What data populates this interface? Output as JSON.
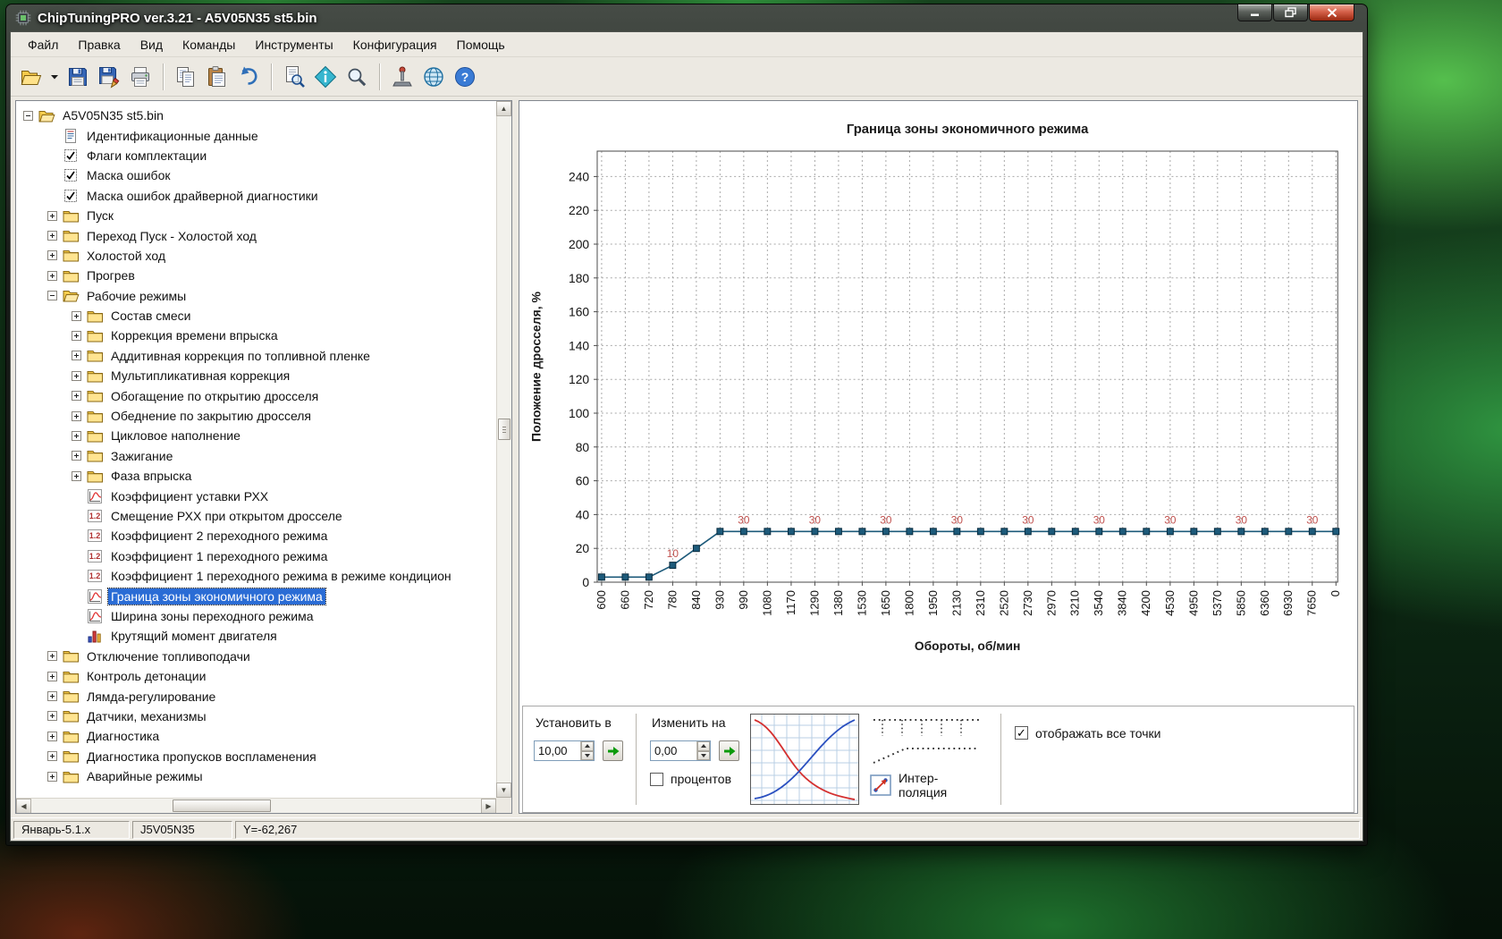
{
  "window": {
    "title": "ChipTuningPRO ver.3.21 - A5V05N35 st5.bin"
  },
  "menu": {
    "items": [
      {
        "key": "file",
        "label": "Файл"
      },
      {
        "key": "edit",
        "label": "Правка"
      },
      {
        "key": "view",
        "label": "Вид"
      },
      {
        "key": "commands",
        "label": "Команды"
      },
      {
        "key": "tools",
        "label": "Инструменты"
      },
      {
        "key": "configuration",
        "label": "Конфигурация"
      },
      {
        "key": "help",
        "label": "Помощь"
      }
    ]
  },
  "toolbar": {
    "buttons": [
      {
        "name": "open-file-button",
        "icon": "open"
      },
      {
        "name": "open-dropdown-button",
        "icon": "dropdown"
      },
      {
        "name": "save-button",
        "icon": "save"
      },
      {
        "name": "save-as-button",
        "icon": "save-as"
      },
      {
        "name": "print-button",
        "icon": "print"
      },
      {
        "name": "separator"
      },
      {
        "name": "copy-button",
        "icon": "copy"
      },
      {
        "name": "paste-button",
        "icon": "paste"
      },
      {
        "name": "undo-button",
        "icon": "undo"
      },
      {
        "name": "separator"
      },
      {
        "name": "preview-button",
        "icon": "preview"
      },
      {
        "name": "properties-button",
        "icon": "info"
      },
      {
        "name": "search-button",
        "icon": "search"
      },
      {
        "name": "separator"
      },
      {
        "name": "tools-button",
        "icon": "tools"
      },
      {
        "name": "globe-button",
        "icon": "globe"
      },
      {
        "name": "help-button",
        "icon": "help"
      }
    ]
  },
  "tree": {
    "items": [
      {
        "label": "A5V05N35 st5.bin",
        "level": 0,
        "icon": "folder-open",
        "expander": "minus"
      },
      {
        "label": "Идентификационные данные",
        "level": 1,
        "icon": "doc"
      },
      {
        "label": "Флаги комплектации",
        "level": 1,
        "icon": "check"
      },
      {
        "label": "Маска ошибок",
        "level": 1,
        "icon": "check"
      },
      {
        "label": "Маска ошибок драйверной диагностики",
        "level": 1,
        "icon": "check"
      },
      {
        "label": "Пуск",
        "level": 1,
        "icon": "folder",
        "expander": "plus"
      },
      {
        "label": "Переход Пуск - Холостой ход",
        "level": 1,
        "icon": "folder",
        "expander": "plus"
      },
      {
        "label": "Холостой ход",
        "level": 1,
        "icon": "folder",
        "expander": "plus"
      },
      {
        "label": "Прогрев",
        "level": 1,
        "icon": "folder",
        "expander": "plus"
      },
      {
        "label": "Рабочие режимы",
        "level": 1,
        "icon": "folder-open",
        "expander": "minus"
      },
      {
        "label": "Состав смеси",
        "level": 2,
        "icon": "folder",
        "expander": "plus"
      },
      {
        "label": "Коррекция времени впрыска",
        "level": 2,
        "icon": "folder",
        "expander": "plus"
      },
      {
        "label": "Аддитивная коррекция по топливной пленке",
        "level": 2,
        "icon": "folder",
        "expander": "plus"
      },
      {
        "label": "Мультипликативная коррекция",
        "level": 2,
        "icon": "folder",
        "expander": "plus"
      },
      {
        "label": "Обогащение по открытию дросселя",
        "level": 2,
        "icon": "folder",
        "expander": "plus"
      },
      {
        "label": "Обеднение по закрытию дросселя",
        "level": 2,
        "icon": "folder",
        "expander": "plus"
      },
      {
        "label": "Цикловое наполнение",
        "level": 2,
        "icon": "folder",
        "expander": "plus"
      },
      {
        "label": "Зажигание",
        "level": 2,
        "icon": "folder",
        "expander": "plus"
      },
      {
        "label": "Фаза впрыска",
        "level": 2,
        "icon": "folder",
        "expander": "plus"
      },
      {
        "label": "Коэффициент уставки РХХ",
        "level": 2,
        "icon": "chart"
      },
      {
        "label": "Смещение РХХ при открытом дросселе",
        "level": 2,
        "icon": "num"
      },
      {
        "label": "Коэффициент 2 переходного режима",
        "level": 2,
        "icon": "num"
      },
      {
        "label": "Коэффициент 1 переходного режима",
        "level": 2,
        "icon": "num"
      },
      {
        "label": "Коэффициент 1 переходного режима в режиме кондицион",
        "level": 2,
        "icon": "num"
      },
      {
        "label": "Граница зоны экономичного режима",
        "level": 2,
        "icon": "chart",
        "selected": true
      },
      {
        "label": "Ширина зоны переходного режима",
        "level": 2,
        "icon": "chart"
      },
      {
        "label": "Крутящий момент двигателя",
        "level": 2,
        "icon": "bars"
      },
      {
        "label": "Отключение топливоподачи",
        "level": 1,
        "icon": "folder",
        "expander": "plus"
      },
      {
        "label": "Контроль детонации",
        "level": 1,
        "icon": "folder",
        "expander": "plus"
      },
      {
        "label": "Лямда-регулирование",
        "level": 1,
        "icon": "folder",
        "expander": "plus"
      },
      {
        "label": "Датчики, механизмы",
        "level": 1,
        "icon": "folder",
        "expander": "plus"
      },
      {
        "label": "Диагностика",
        "level": 1,
        "icon": "folder",
        "expander": "plus"
      },
      {
        "label": "Диагностика пропусков воспламенения",
        "level": 1,
        "icon": "folder",
        "expander": "plus"
      },
      {
        "label": "Аварийные режимы",
        "level": 1,
        "icon": "folder",
        "expander": "plus"
      }
    ]
  },
  "chart_data": {
    "type": "line",
    "title": "Граница зоны экономичного режима",
    "xlabel": "Обороты, об/мин",
    "ylabel": "Положение дросселя, %",
    "ylim": [
      0,
      255
    ],
    "ymax_tick": 240,
    "ytick_step": 20,
    "grid": true,
    "categories": [
      "600",
      "660",
      "720",
      "780",
      "840",
      "930",
      "990",
      "1080",
      "1170",
      "1290",
      "1380",
      "1530",
      "1650",
      "1800",
      "1950",
      "2130",
      "2310",
      "2520",
      "2730",
      "2970",
      "3210",
      "3540",
      "3840",
      "4200",
      "4530",
      "4950",
      "5370",
      "5850",
      "6360",
      "6930",
      "7650",
      "0"
    ],
    "values": [
      3,
      3,
      3,
      10,
      20,
      30,
      30,
      30,
      30,
      30,
      30,
      30,
      30,
      30,
      30,
      30,
      30,
      30,
      30,
      30,
      30,
      30,
      30,
      30,
      30,
      30,
      30,
      30,
      30,
      30,
      30,
      30
    ],
    "point_labels": [
      {
        "index": 3,
        "text": "10"
      },
      {
        "index": 6,
        "text": "30"
      },
      {
        "index": 9,
        "text": "30"
      },
      {
        "index": 12,
        "text": "30"
      },
      {
        "index": 15,
        "text": "30"
      },
      {
        "index": 18,
        "text": "30"
      },
      {
        "index": 21,
        "text": "30"
      },
      {
        "index": 24,
        "text": "30"
      },
      {
        "index": 27,
        "text": "30"
      },
      {
        "index": 30,
        "text": "30"
      }
    ],
    "line_color": "#1d5a7a",
    "marker_color": "#1d5a7a",
    "label_color": "#c0504d"
  },
  "controls": {
    "set_to": {
      "label": "Установить в",
      "value": "10,00"
    },
    "change_by": {
      "label": "Изменить на",
      "value": "0,00"
    },
    "percent_label": "процентов",
    "percent_checked": false,
    "interpolation_label": "Интер-поляция",
    "show_points_label": "отображать все точки",
    "show_points_checked": true
  },
  "statusbar": {
    "panels": [
      "Январь-5.1.x",
      "J5V05N35",
      "Y=-62,267"
    ]
  }
}
